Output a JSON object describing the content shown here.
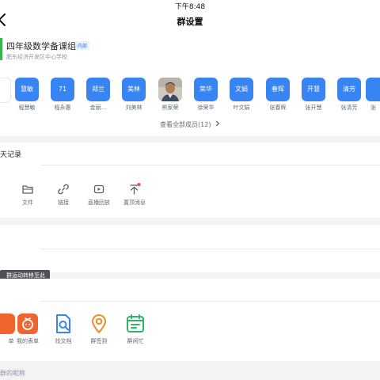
{
  "status_bar": {
    "time": "下午8:48"
  },
  "nav": {
    "title": "群设置",
    "back_icon": "chevron-left-icon"
  },
  "group": {
    "name": "四年级数学备课组",
    "tag": "内部",
    "org": "肥东经济开发区中心学校",
    "accent_color": "#3ab54a"
  },
  "members": [
    {
      "avatar_text": "慧敏",
      "name": "程慧敏"
    },
    {
      "avatar_text": "71",
      "name": "程永惠"
    },
    {
      "avatar_text": "郑兰",
      "name": "金丽..."
    },
    {
      "avatar_text": "美林",
      "name": "刘美林"
    },
    {
      "avatar_text": "",
      "name": "熊家荣",
      "photo": true
    },
    {
      "avatar_text": "荣华",
      "name": "徐荣华"
    },
    {
      "avatar_text": "文娟",
      "name": "叶文娟"
    },
    {
      "avatar_text": "春辉",
      "name": "张春辉"
    },
    {
      "avatar_text": "开慧",
      "name": "张开慧"
    },
    {
      "avatar_text": "清芳",
      "name": "张清芳"
    },
    {
      "avatar_text": "",
      "name": "张"
    }
  ],
  "members_link": "查看全部成员(12)",
  "chat_record": {
    "label": "天记录",
    "tools": [
      {
        "label": "文件",
        "icon": "folder-icon"
      },
      {
        "label": "链接",
        "icon": "link-icon"
      },
      {
        "label": "直播回放",
        "icon": "live-replay-icon"
      },
      {
        "label": "置顶消息",
        "icon": "pin-icon"
      }
    ]
  },
  "tooltip": "群运动转移至此",
  "apps": [
    {
      "label": "单",
      "icon": "form-icon"
    },
    {
      "label": "我的表单",
      "icon": "my-form-icon"
    },
    {
      "label": "找文档",
      "icon": "find-doc-icon"
    },
    {
      "label": "群签到",
      "icon": "check-in-icon"
    },
    {
      "label": "群闲忙",
      "icon": "calendar-icon"
    }
  ],
  "nickname_label": "群的昵称",
  "colors": {
    "accent": "#3884f2",
    "background": "#f2f3f5"
  }
}
